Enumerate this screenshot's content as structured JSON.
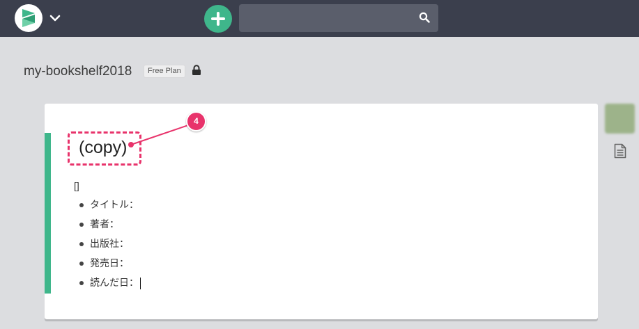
{
  "header": {
    "logo_icon": "app-logo-icon",
    "menu_icon": "chevron-down-icon",
    "add_icon": "plus-icon",
    "search": {
      "value": "",
      "placeholder": ""
    },
    "search_icon": "search-icon"
  },
  "team": {
    "name": "my-bookshelf2018",
    "plan": "Free Plan",
    "visibility_icon": "lock-icon"
  },
  "editor": {
    "title": "(copy)",
    "tags": "[]",
    "fields": [
      {
        "label": "タイトル："
      },
      {
        "label": "著者："
      },
      {
        "label": "出版社："
      },
      {
        "label": "発売日："
      },
      {
        "label": "読んだ日："
      }
    ]
  },
  "annotation": {
    "number": "4"
  },
  "side": {
    "doc_icon": "document-icon"
  },
  "colors": {
    "topbar": "#3b3f4d",
    "accent": "#3fb68b",
    "annotation": "#e8336b",
    "background": "#dcdde0"
  }
}
